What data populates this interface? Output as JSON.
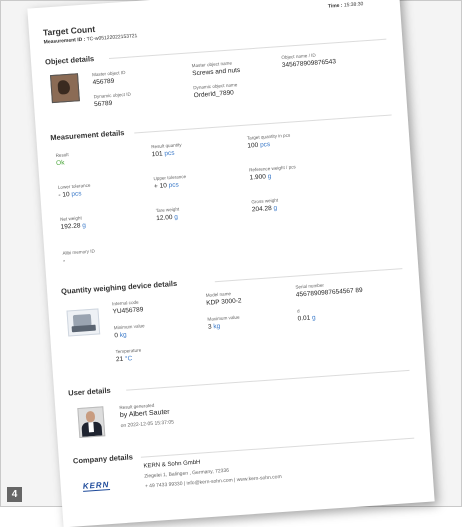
{
  "figure_number": "4",
  "header": {
    "title": "Target Count",
    "measurement_id_label": "Measurement ID :",
    "measurement_id": "TC-w05122022153721",
    "time_label": "Time :",
    "time_value": "15:38:30"
  },
  "object_details": {
    "heading": "Object details",
    "master_object_id_label": "Master object ID",
    "master_object_id": "456789",
    "master_object_name_label": "Master object name",
    "master_object_name": "Screws and nuts",
    "object_name_id_label": "Object name / ID",
    "object_name_id": "345678909876543",
    "dynamic_object_id_label": "Dynamic object ID",
    "dynamic_object_id": "56789",
    "dynamic_object_name_label": "Dynamic object name",
    "dynamic_object_name": "OrderId_7890"
  },
  "measurement_details": {
    "heading": "Measurement details",
    "result_label": "Result",
    "result": "Ok",
    "result_quantity_label": "Result quantity",
    "result_quantity": "101",
    "result_quantity_unit": "pcs",
    "target_quantity_label": "Target quantity in pcs",
    "target_quantity": "100",
    "target_quantity_unit": "pcs",
    "lower_tolerance_label": "Lower tolerance",
    "lower_tolerance": "- 10",
    "lower_tolerance_unit": "pcs",
    "upper_tolerance_label": "Upper tolerance",
    "upper_tolerance": "+ 10",
    "upper_tolerance_unit": "pcs",
    "reference_weight_label": "Reference weight / pcs",
    "reference_weight": "1.900",
    "reference_weight_unit": "g",
    "net_weight_label": "Net weight",
    "net_weight": "192.28",
    "net_weight_unit": "g",
    "tare_weight_label": "Tare weight",
    "tare_weight": "12.00",
    "tare_weight_unit": "g",
    "gross_weight_label": "Gross weight",
    "gross_weight": "204.28",
    "gross_weight_unit": "g",
    "alibi_memory_label": "Alibi memory ID",
    "alibi_memory": "-"
  },
  "device_details": {
    "heading": "Quantity weighing device details",
    "internal_code_label": "Internal code",
    "internal_code": "YU456789",
    "model_name_label": "Model name",
    "model_name": "KDP 3000-2",
    "serial_number_label": "Serial number",
    "serial_number": "4567890987654567 89",
    "minimum_value_label": "Minimum value",
    "minimum_value": "0",
    "minimum_value_unit": "kg",
    "maximum_value_label": "Maximum value",
    "maximum_value": "3",
    "maximum_value_unit": "kg",
    "d_label": "d",
    "d_value": "0.01",
    "d_unit": "g",
    "temperature_label": "Temperature",
    "temperature": "21",
    "temperature_unit": "°C"
  },
  "user_details": {
    "heading": "User details",
    "result_generated_label": "Result generated",
    "generated_by": "by Albert Sauter",
    "generated_on": "on 2022-12-05 15:37:05"
  },
  "company_details": {
    "heading": "Company details",
    "company_name": "KERN & Sohn GmbH",
    "address": "Ziegelei 1, Balingen , Germany, 72336",
    "contact": "+ 49 7433 99330 | info@kern-sohn.com | www.kern-sohn.com",
    "logo_text": "KERN"
  }
}
